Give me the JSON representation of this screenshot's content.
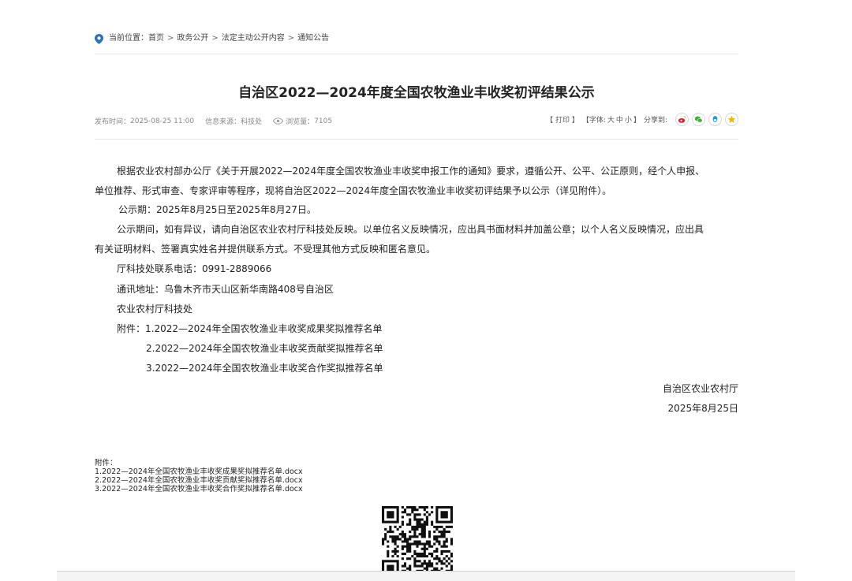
{
  "breadcrumb": {
    "label": "当前位置：",
    "items": [
      "首页",
      "政务公开",
      "法定主动公开内容",
      "通知公告"
    ],
    "separator": ">"
  },
  "article": {
    "title": "自治区2022—2024年度全国农牧渔业丰收奖初评结果公示",
    "meta": {
      "publish_label": "发布时间：",
      "publish_time": "2025-08-25 11:00",
      "source_label": "信息来源：",
      "source": "科技处",
      "views_label": "浏览量：",
      "views": "7105"
    },
    "tools": {
      "print": "【 打印 】",
      "font_prefix": "【字体:",
      "font_large": "大",
      "font_medium": "中",
      "font_small": "小",
      "font_suffix": "】",
      "share_label": "分享到:"
    },
    "share_icons": [
      "weibo-icon",
      "wechat-icon",
      "qq-icon",
      "qzone-icon"
    ],
    "paragraphs": {
      "p1_line1": "根据农业农村部办公厅《关于开展2022—2024年度全国农牧渔业丰收奖申报工作的通知》要求，遵循公开、公平、公正原则，经个人申报、",
      "p1_line2": "单位推荐、形式审查、专家评审等程序，现将自治区2022—2024年度全国农牧渔业丰收奖初评结果予以公示（详见附件）。",
      "p2": "公示期：2025年8月25日至2025年8月27日。",
      "p3_line1": "公示期间，如有异议，请向自治区农业农村厅科技处反映。以单位名义反映情况，应出具书面材料并加盖公章；以个人名义反映情况，应出具",
      "p3_line2": "有关证明材料、签署真实姓名并提供联系方式。不受理其他方式反映和匿名意见。",
      "phone": "厅科技处联系电话：0991-2889066",
      "address": "通讯地址：乌鲁木齐市天山区新华南路408号自治区",
      "dept": "农业农村厅科技处",
      "attach_1": "附件：1.2022—2024年全国农牧渔业丰收奖成果奖拟推荐名单",
      "attach_2": "2.2022—2024年全国农牧渔业丰收奖贡献奖拟推荐名单",
      "attach_3": "3.2022—2024年全国农牧渔业丰收奖合作奖拟推荐名单"
    },
    "signature": {
      "org": "自治区农业农村厅",
      "date": "2025年8月25日"
    }
  },
  "files": {
    "label": "附件：",
    "items": [
      "1.2022—2024年全国农牧渔业丰收奖成果奖拟推荐名单.docx",
      "2.2022—2024年全国农牧渔业丰收奖贡献奖拟推荐名单.docx",
      "3.2022—2024年全国农牧渔业丰收奖合作奖拟推荐名单.docx"
    ]
  },
  "colors": {
    "pin": "#2d6fb8",
    "rule": "#e3e3e3",
    "weibo": "#e6162d",
    "wechat": "#3eb135",
    "qq": "#1e9bd7",
    "qzone": "#f5b800"
  }
}
